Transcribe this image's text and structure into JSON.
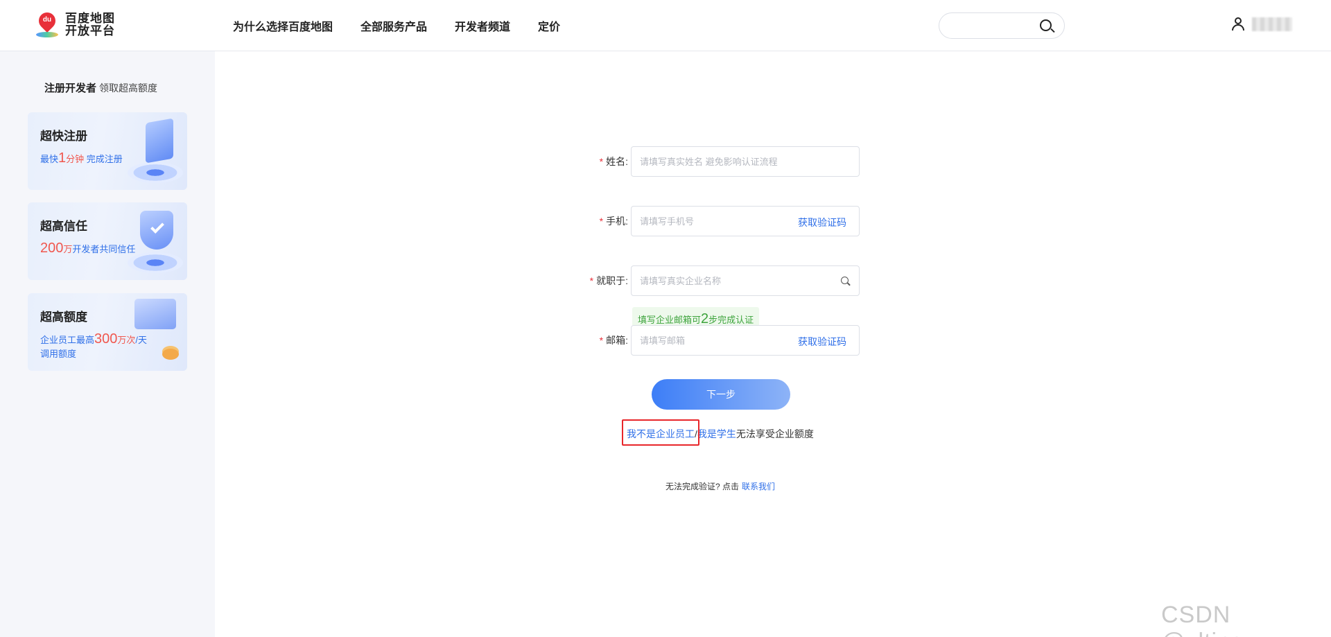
{
  "header": {
    "logo_text_line1": "百度地图",
    "logo_text_line2": "开放平台",
    "nav": [
      "为什么选择百度地图",
      "全部服务产品",
      "开发者频道",
      "定价"
    ],
    "search_placeholder": ""
  },
  "sidebar": {
    "title_bold": "注册开发者",
    "title_rest": "领取超高额度",
    "cards": [
      {
        "title": "超快注册",
        "desc_pre": "最快",
        "desc_num": "1",
        "desc_unit": "分钟",
        "desc_post": "完成注册"
      },
      {
        "title": "超高信任",
        "desc_pre": "",
        "desc_num": "200",
        "desc_unit": "万",
        "desc_post": "开发者共同信任"
      },
      {
        "title": "超高额度",
        "desc_pre": "企业员工最高",
        "desc_num": "300",
        "desc_unit": "万次",
        "desc_post": "/天 调用额度"
      }
    ]
  },
  "form": {
    "required_mark": "*",
    "name": {
      "label": "姓名:",
      "placeholder": "请填写真实姓名 避免影响认证流程"
    },
    "phone": {
      "label": "手机:",
      "placeholder": "请填写手机号",
      "code_button": "获取验证码"
    },
    "company": {
      "label": "就职于:",
      "placeholder": "请填写真实企业名称"
    },
    "email_hint": {
      "pre": "填写企业邮箱可",
      "num": "2",
      "post": "步完成认证"
    },
    "email": {
      "label": "邮箱:",
      "placeholder": "请填写邮箱",
      "code_button": "获取验证码"
    },
    "next_button": "下一步",
    "alt_not_employee": "我不是企业员工",
    "alt_sep": "/",
    "alt_student": "我是学生",
    "alt_suffix": "无法享受企业额度",
    "contact_text": "无法完成验证? 点击",
    "contact_link": "联系我们"
  },
  "watermark": "CSDN @zlting_",
  "colors": {
    "accent": "#2f6fe8",
    "required": "#e8303a",
    "highlight": "#e8262a",
    "hint_green": "#3da33c"
  }
}
